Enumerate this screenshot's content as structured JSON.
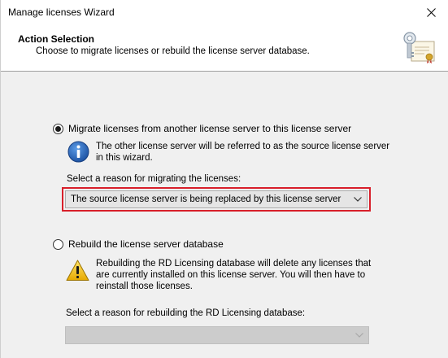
{
  "window": {
    "title": "Manage licenses Wizard"
  },
  "header": {
    "title": "Action Selection",
    "subtitle": "Choose to migrate licenses or rebuild the license server database."
  },
  "migrate": {
    "radio_label": "Migrate licenses from another license server to this license server",
    "selected": true,
    "info_line1": "The other license server will be referred to as the source license server",
    "info_line2": "in this wizard.",
    "select_label": "Select a reason for migrating the licenses:",
    "dropdown_value": "The source license server is being replaced by this license server"
  },
  "rebuild": {
    "radio_label": "Rebuild the license server database",
    "selected": false,
    "warn_line1": "Rebuilding the RD Licensing database will delete any licenses that",
    "warn_line2": "are currently installed on this license server. You will then have to",
    "warn_line3": "reinstall those licenses.",
    "select_label": "Select a reason for rebuilding the RD Licensing database:",
    "dropdown_value": ""
  },
  "icons": {
    "close": "close-icon",
    "header": "license-certificate-icon",
    "info": "info-icon",
    "warning": "warning-icon",
    "chevron": "chevron-down-icon"
  },
  "colors": {
    "highlight": "#d81f2a",
    "info_blue": "#1e5fb4",
    "warning_yellow": "#f5c518"
  }
}
